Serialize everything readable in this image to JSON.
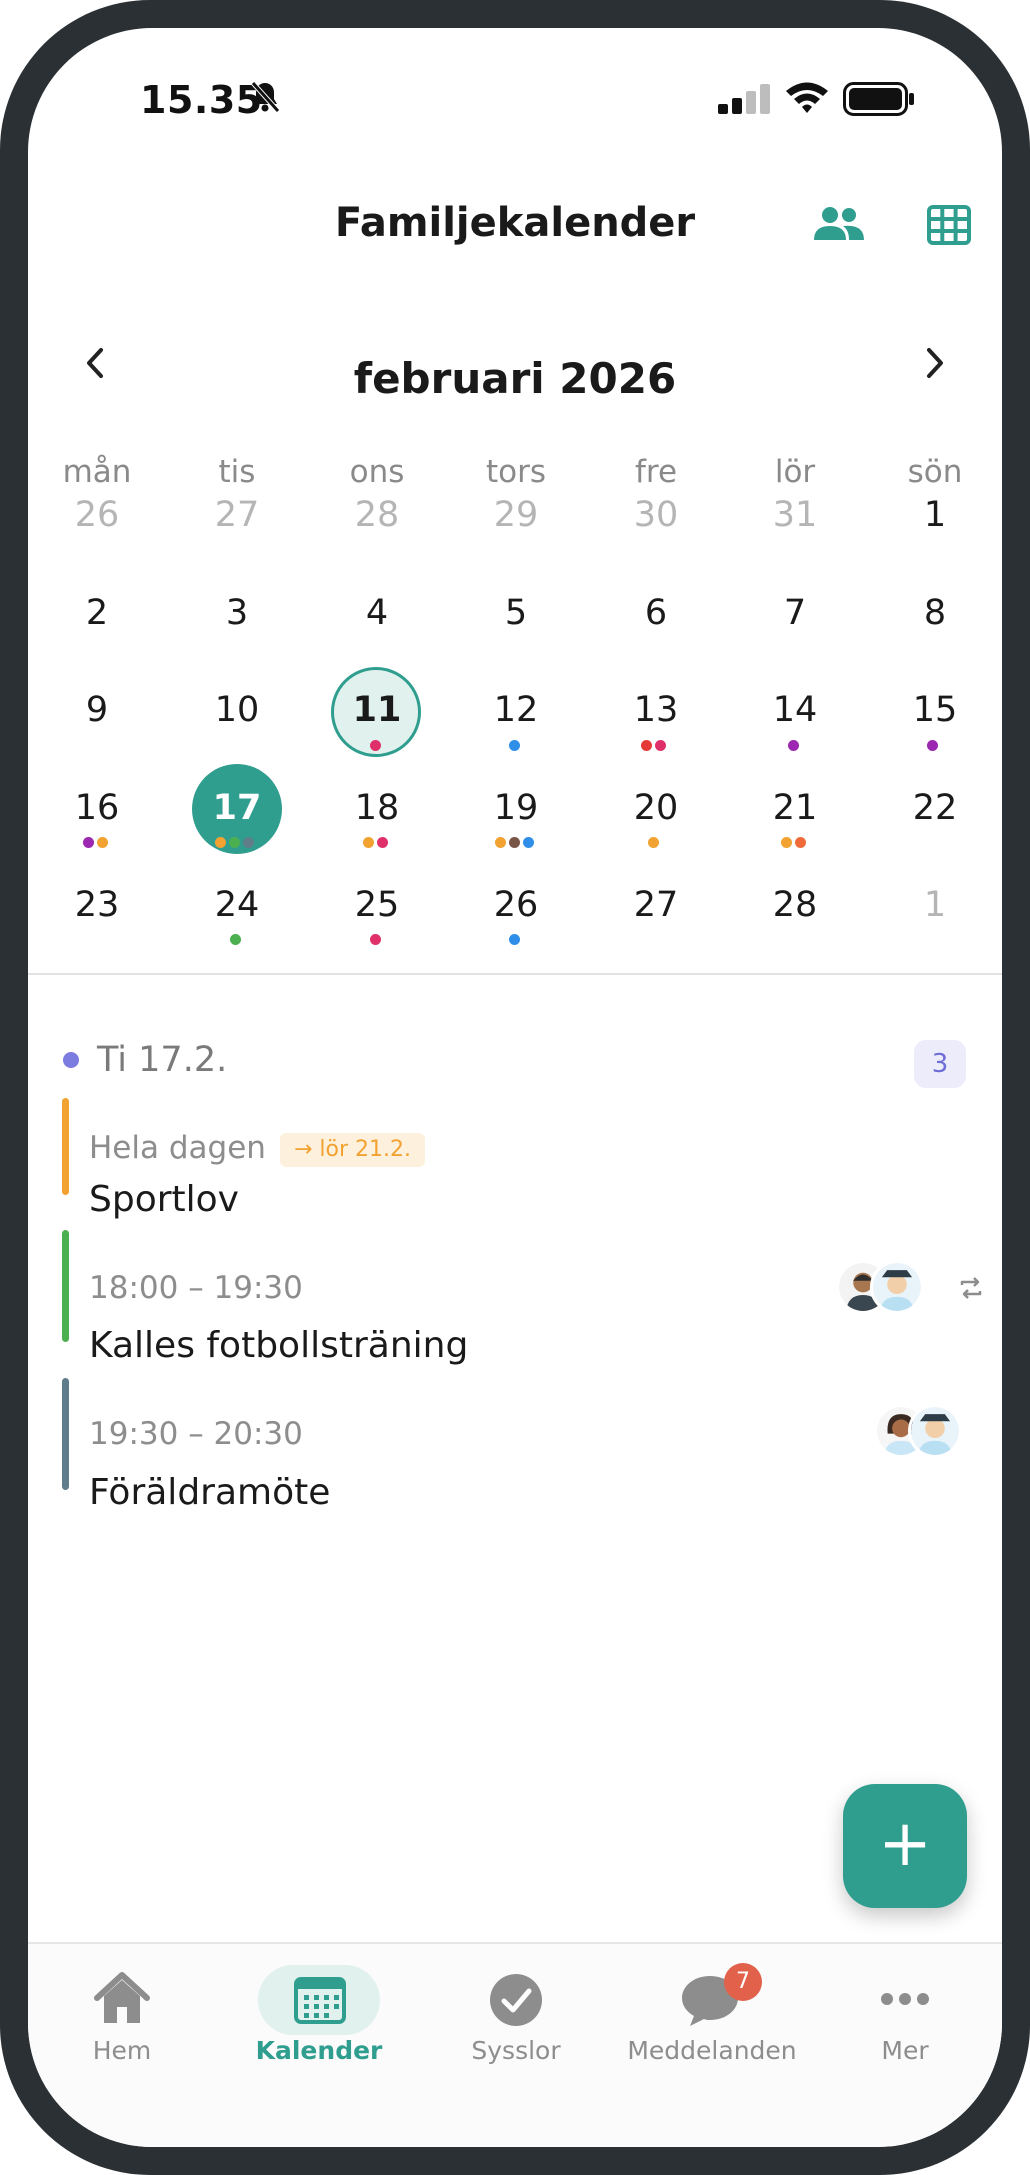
{
  "status": {
    "time": "15.35"
  },
  "header": {
    "title": "Familjekalender"
  },
  "calendar": {
    "month": "februari 2026",
    "weekdays": [
      "mån",
      "tis",
      "ons",
      "tors",
      "fre",
      "lör",
      "sön"
    ],
    "weeks": [
      [
        "26",
        "27",
        "28",
        "29",
        "30",
        "31",
        "1"
      ],
      [
        "2",
        "3",
        "4",
        "5",
        "6",
        "7",
        "8"
      ],
      [
        "9",
        "10",
        "11",
        "12",
        "13",
        "14",
        "15"
      ],
      [
        "16",
        "17",
        "18",
        "19",
        "20",
        "21",
        "22"
      ],
      [
        "23",
        "24",
        "25",
        "26",
        "27",
        "28",
        "1"
      ]
    ],
    "today": "11",
    "selected": "17"
  },
  "agenda": {
    "day_label": "Ti 17.2.",
    "count": "3",
    "events": [
      {
        "time": "Hela dagen",
        "tag": "→ lör 21.2.",
        "title": "Sportlov",
        "color": "#f2a230"
      },
      {
        "time": "18:00 – 19:30",
        "title": "Kalles fotbollsträning",
        "color": "#4caf50"
      },
      {
        "time": "19:30 – 20:30",
        "title": "Föräldramöte",
        "color": "#607d8b"
      }
    ]
  },
  "fab": {
    "label": "+"
  },
  "tabs": [
    {
      "label": "Hem"
    },
    {
      "label": "Kalender"
    },
    {
      "label": "Sysslor"
    },
    {
      "label": "Meddelanden",
      "badge": "7"
    },
    {
      "label": "Mer"
    }
  ],
  "colors": {
    "accent": "#2f9e8f",
    "badge": "#e2614b"
  }
}
